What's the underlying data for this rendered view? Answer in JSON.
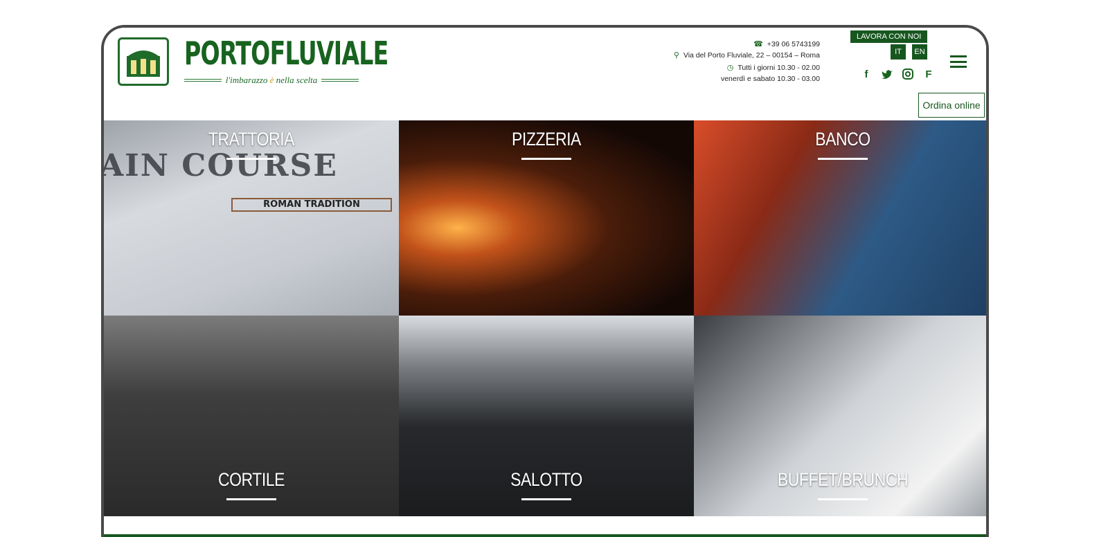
{
  "brand": {
    "name": "PORTOFLUVIALE",
    "tagline_pre": "l'imbarazzo ",
    "tagline_accent": "è",
    "tagline_post": " nella scelta"
  },
  "contact": {
    "phone": "+39 06 5743199",
    "address": "Via del Porto Fluviale, 22 – 00154 – Roma",
    "hours_line1": "Tutti i giorni 10.30 - 02.00",
    "hours_line2": "venerdì e sabato 10.30 - 03.00"
  },
  "header": {
    "work_with_us": "LAVORA CON NOI",
    "lang_it": "IT",
    "lang_en": "EN",
    "order_online": "Ordina online"
  },
  "social": [
    {
      "icon": "facebook-icon",
      "glyph": "f"
    },
    {
      "icon": "twitter-icon",
      "glyph": "🐦"
    },
    {
      "icon": "instagram-icon",
      "glyph": "◎"
    },
    {
      "icon": "foursquare-icon",
      "glyph": "F"
    }
  ],
  "tiles": [
    {
      "label": "TRATTORIA"
    },
    {
      "label": "PIZZERIA"
    },
    {
      "label": "BANCO"
    },
    {
      "label": "CORTILE"
    },
    {
      "label": "SALOTTO"
    },
    {
      "label": "BUFFET/BRUNCH"
    }
  ],
  "photo_text": {
    "menu_heading": "AIN COURSE",
    "menu_banner": "ROMAN TRADITION"
  },
  "colors": {
    "brand_green": "#17571f",
    "accent_gold": "#c79a1a"
  }
}
